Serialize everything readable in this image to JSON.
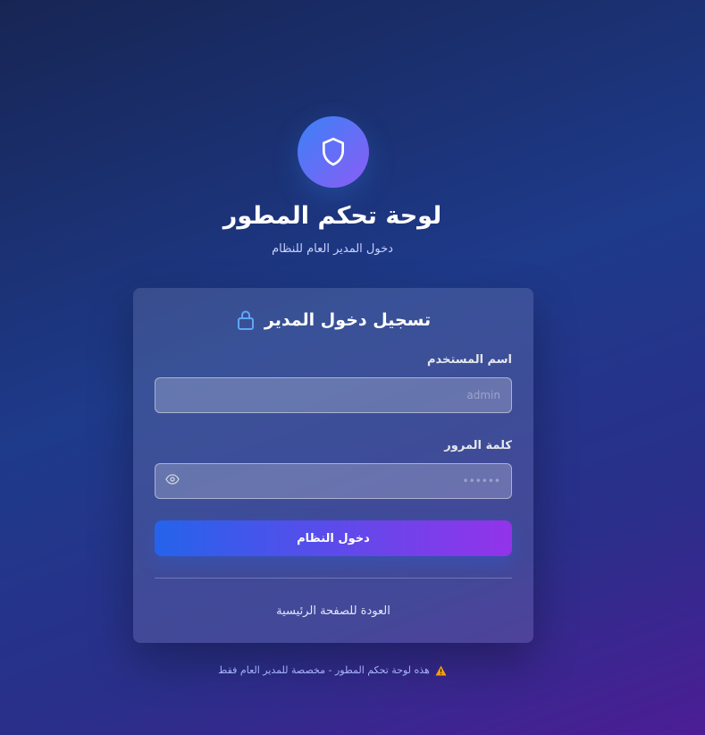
{
  "header": {
    "logo_icon": "shield-icon",
    "title": "لوحة تحكم المطور",
    "subtitle": "دخول المدير العام للنظام"
  },
  "login_card": {
    "title": "تسجيل دخول المدير",
    "title_icon": "lock-icon",
    "username": {
      "label": "اسم المستخدم",
      "value": "",
      "placeholder": "admin"
    },
    "password": {
      "label": "كلمة المرور",
      "value": "",
      "placeholder": "••••••",
      "toggle_icon": "eye-icon"
    },
    "submit_label": "دخول النظام",
    "back_link": "العودة للصفحة الرئيسية"
  },
  "footer": {
    "icon": "warning-icon",
    "text": "هذه لوحة تحكم المطور - مخصصة للمدير العام فقط"
  },
  "colors": {
    "accent_start": "#2563eb",
    "accent_end": "#9333ea",
    "warning": "#f59e0b"
  }
}
